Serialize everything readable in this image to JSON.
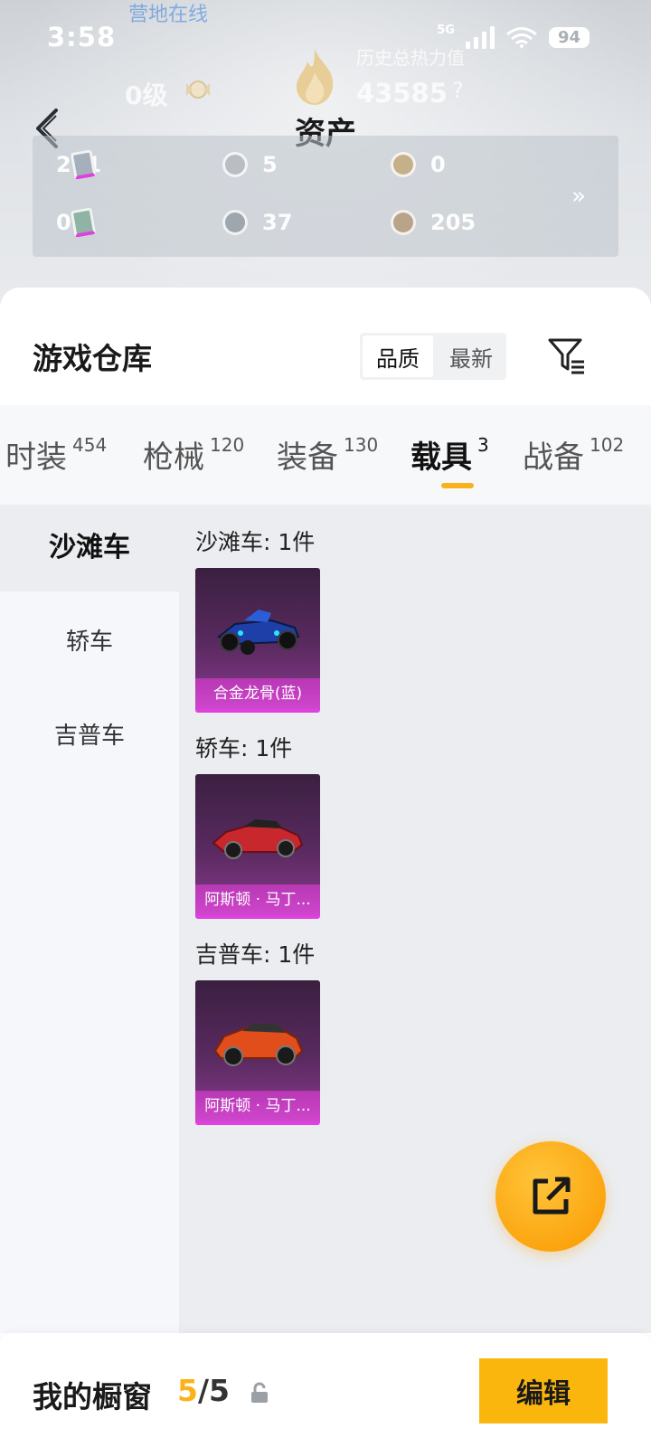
{
  "status_bar": {
    "time": "3:58",
    "network": "5G",
    "battery": "94"
  },
  "background": {
    "text": "营地在线",
    "level": "0级",
    "history_label": "历史总热力值",
    "history_value": "43585",
    "help": "?"
  },
  "header": {
    "title": "资产"
  },
  "assets": [
    {
      "icon": "card-icon",
      "value": "211"
    },
    {
      "icon": "silver-coin-icon",
      "value": "5"
    },
    {
      "icon": "gold-coin-icon",
      "value": "0"
    },
    {
      "icon": "green-card-icon",
      "value": "0"
    },
    {
      "icon": "gray-coin-icon",
      "value": "37"
    },
    {
      "icon": "bronze-coin-icon",
      "value": "205"
    }
  ],
  "warehouse": {
    "title": "游戏仓库",
    "sort_options": [
      "品质",
      "最新"
    ],
    "sort_selected": "品质"
  },
  "tabs": [
    {
      "label": "时装",
      "count": "454"
    },
    {
      "label": "枪械",
      "count": "120"
    },
    {
      "label": "装备",
      "count": "130"
    },
    {
      "label": "载具",
      "count": "3",
      "active": true
    },
    {
      "label": "战备",
      "count": "102"
    }
  ],
  "sidebar": [
    {
      "label": "沙滩车",
      "active": true
    },
    {
      "label": "轿车"
    },
    {
      "label": "吉普车"
    }
  ],
  "groups": [
    {
      "title": "沙滩车: 1件",
      "items": [
        {
          "name": "合金龙骨(蓝)"
        }
      ]
    },
    {
      "title": "轿车: 1件",
      "items": [
        {
          "name": "阿斯顿 · 马丁..."
        }
      ]
    },
    {
      "title": "吉普车: 1件",
      "items": [
        {
          "name": "阿斯顿 · 马丁..."
        }
      ]
    }
  ],
  "showcase": {
    "label": "我的橱窗",
    "current": "5",
    "separator": "/",
    "total": "5",
    "edit_label": "编辑"
  },
  "colors": {
    "accent": "#fbb21a",
    "card_purple": "#8a3a8e",
    "label_magenta": "#cf46cc"
  }
}
